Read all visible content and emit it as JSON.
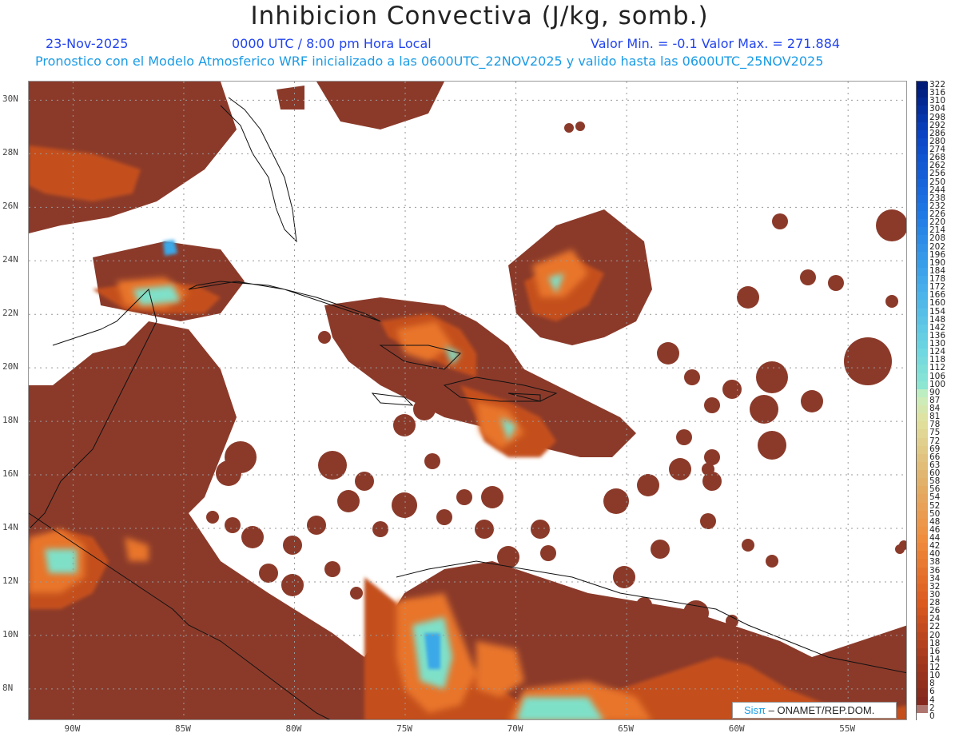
{
  "header": {
    "title": "Inhibicion Convectiva (J/kg, somb.)",
    "date": "23-Nov-2025",
    "time": "0000 UTC / 8:00 pm Hora Local",
    "minmax": "Valor Min. = -0.1  Valor Max. = 271.884",
    "subtitle": "Pronostico con el Modelo Atmosferico WRF inicializado a las 0600UTC_22NOV2025 y valido hasta las  0600UTC_25NOV2025"
  },
  "map": {
    "lon_range": [
      -92,
      -52.3
    ],
    "lat_range": [
      6.8,
      30.7
    ],
    "lat_ticks": [
      {
        "value": 30,
        "label": "30N"
      },
      {
        "value": 28,
        "label": "28N"
      },
      {
        "value": 26,
        "label": "26N"
      },
      {
        "value": 24,
        "label": "24N"
      },
      {
        "value": 22,
        "label": "22N"
      },
      {
        "value": 20,
        "label": "20N"
      },
      {
        "value": 18,
        "label": "18N"
      },
      {
        "value": 16,
        "label": "16N"
      },
      {
        "value": 14,
        "label": "14N"
      },
      {
        "value": 12,
        "label": "12N"
      },
      {
        "value": 10,
        "label": "10N"
      },
      {
        "value": 8,
        "label": "8N"
      }
    ],
    "lon_ticks": [
      {
        "value": -90,
        "label": "90W"
      },
      {
        "value": -85,
        "label": "85W"
      },
      {
        "value": -80,
        "label": "80W"
      },
      {
        "value": -75,
        "label": "75W"
      },
      {
        "value": -70,
        "label": "70W"
      },
      {
        "value": -65,
        "label": "65W"
      },
      {
        "value": -60,
        "label": "60W"
      },
      {
        "value": -55,
        "label": "55W"
      }
    ],
    "field_colors": {
      "low": "#8b3a2a",
      "mid": "#c4501e",
      "high": "#e8752a",
      "very_high": "#7fe0c8",
      "peak": "#3aa8e8"
    }
  },
  "colorbar": {
    "labels": [
      "322",
      "316",
      "310",
      "304",
      "298",
      "292",
      "286",
      "280",
      "274",
      "268",
      "262",
      "256",
      "250",
      "244",
      "238",
      "232",
      "226",
      "220",
      "214",
      "208",
      "202",
      "196",
      "190",
      "184",
      "178",
      "172",
      "166",
      "160",
      "154",
      "148",
      "142",
      "136",
      "130",
      "124",
      "118",
      "112",
      "106",
      "100",
      "90",
      "87",
      "84",
      "81",
      "78",
      "75",
      "72",
      "69",
      "66",
      "63",
      "60",
      "58",
      "56",
      "54",
      "52",
      "50",
      "48",
      "46",
      "44",
      "42",
      "40",
      "38",
      "36",
      "34",
      "32",
      "30",
      "28",
      "26",
      "24",
      "22",
      "20",
      "18",
      "16",
      "14",
      "12",
      "10",
      "8",
      "6",
      "4",
      "2",
      "0"
    ]
  },
  "credit": {
    "sis": "Sisπ",
    "org": " – ONAMET/REP.DOM."
  }
}
